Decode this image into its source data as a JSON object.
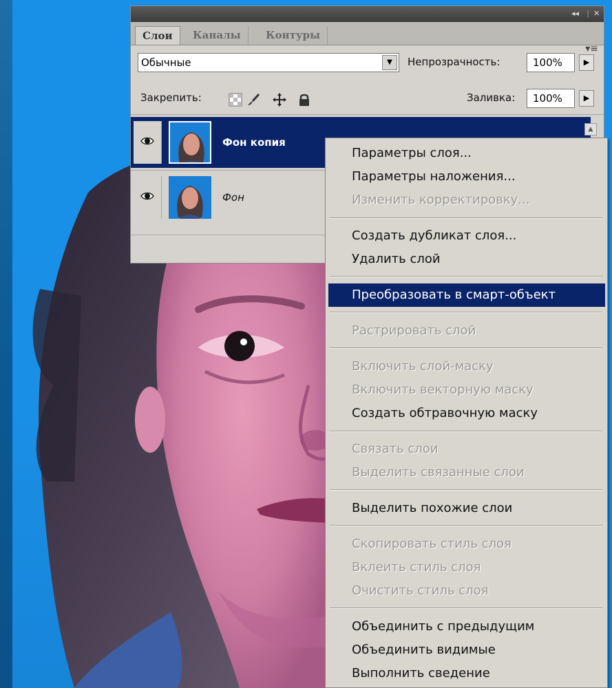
{
  "panel": {
    "tabs": [
      "Слои",
      "Каналы",
      "Контуры"
    ],
    "blend_mode": "Обычные",
    "opacity_label": "Непрозрачность:",
    "opacity_value": "100%",
    "lock_label": "Закрепить:",
    "fill_label": "Заливка:",
    "fill_value": "100%",
    "layers": [
      {
        "name": "Фон копия",
        "selected": true
      },
      {
        "name": "Фон",
        "selected": false
      }
    ],
    "icons": [
      "collapse-icon",
      "close-icon",
      "panel-menu-icon",
      "eye-icon",
      "lock-transparency-icon",
      "lock-paint-icon",
      "lock-move-icon",
      "lock-all-icon",
      "dropdown-arrow-icon",
      "flyout-arrow-icon"
    ]
  },
  "menu": {
    "items": [
      {
        "label": "Параметры слоя...",
        "enabled": true
      },
      {
        "label": "Параметры наложения...",
        "enabled": true
      },
      {
        "label": "Изменить корректировку...",
        "enabled": false
      },
      {
        "label": "Создать дубликат слоя...",
        "enabled": true
      },
      {
        "label": "Удалить слой",
        "enabled": true
      },
      {
        "label": "Преобразовать в смарт-объект",
        "enabled": true,
        "highlighted": true
      },
      {
        "label": "Растрировать слой",
        "enabled": false
      },
      {
        "label": "Включить слой-маску",
        "enabled": false
      },
      {
        "label": "Включить векторную маску",
        "enabled": false
      },
      {
        "label": "Создать обтравочную маску",
        "enabled": true
      },
      {
        "label": "Связать слои",
        "enabled": false
      },
      {
        "label": "Выделить связанные слои",
        "enabled": false
      },
      {
        "label": "Выделить похожие слои",
        "enabled": true
      },
      {
        "label": "Скопировать стиль слоя",
        "enabled": false
      },
      {
        "label": "Вклеить стиль слоя",
        "enabled": false
      },
      {
        "label": "Очистить стиль слоя",
        "enabled": false
      },
      {
        "label": "Объединить с предыдущим",
        "enabled": true
      },
      {
        "label": "Объединить видимые",
        "enabled": true
      },
      {
        "label": "Выполнить сведение",
        "enabled": true
      }
    ]
  },
  "colors": {
    "selection": "#0a246a",
    "photo_background": "#1a8fe6",
    "panel_background": "#d6d3ce"
  }
}
